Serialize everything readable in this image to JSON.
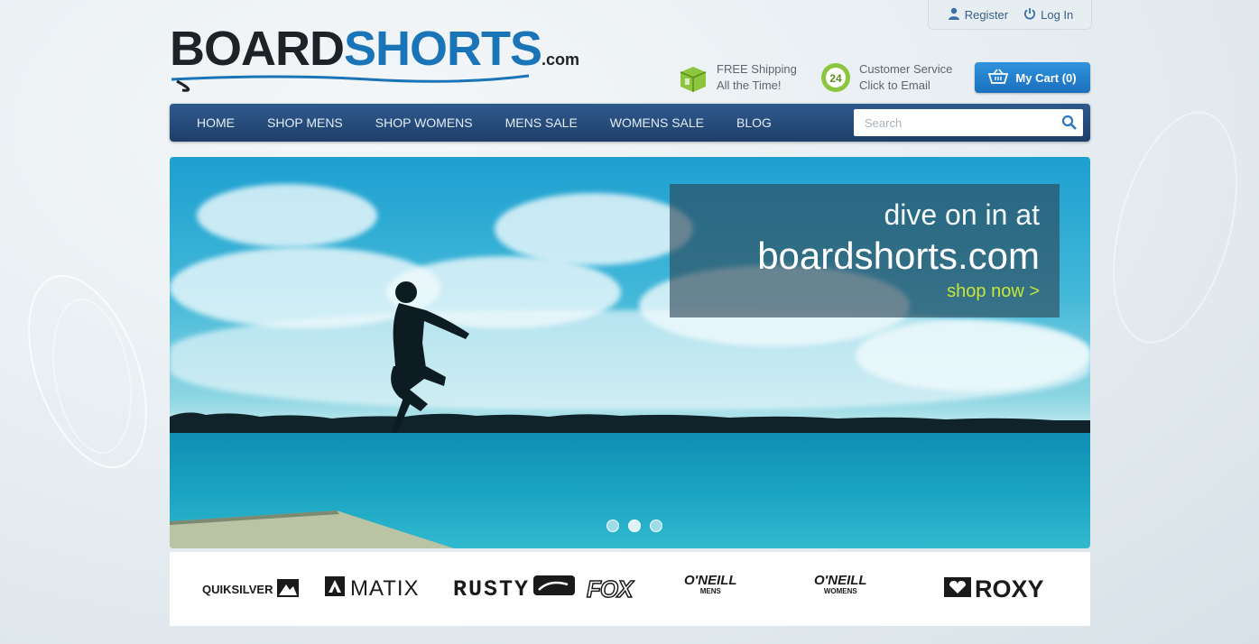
{
  "account": {
    "register": "Register",
    "login": "Log In"
  },
  "logo": {
    "board": "BOARD",
    "shorts": "SHORTS",
    "com": ".com"
  },
  "promos": {
    "shipping": {
      "line1": "FREE Shipping",
      "line2": "All the Time!"
    },
    "service": {
      "line1": "Customer Service",
      "line2": "Click to Email",
      "badge": "24"
    }
  },
  "cart": {
    "label": "My Cart (0)"
  },
  "nav": {
    "items": [
      {
        "label": "HOME"
      },
      {
        "label": "SHOP MENS"
      },
      {
        "label": "SHOP WOMENS"
      },
      {
        "label": "MENS SALE"
      },
      {
        "label": "WOMENS SALE"
      },
      {
        "label": "BLOG"
      }
    ]
  },
  "search": {
    "placeholder": "Search",
    "value": ""
  },
  "hero": {
    "line1": "dive on in at",
    "line2": "boardshorts.com",
    "cta": "shop now >",
    "slides": 3,
    "active_slide": 2
  },
  "brands": {
    "quiksilver": "QUIKSILVER",
    "matix": "MATIX",
    "rusty": "RUSTY",
    "fox": "FOX",
    "oneill_mens": {
      "name": "O'NEILL",
      "sub": "MENS"
    },
    "oneill_womens": {
      "name": "O'NEILL",
      "sub": "WOMENS"
    },
    "roxy": "ROXY"
  },
  "colors": {
    "nav": "#26497a",
    "accent": "#1a74b8",
    "cta": "#c7e63a",
    "cart": "#2585d0"
  }
}
